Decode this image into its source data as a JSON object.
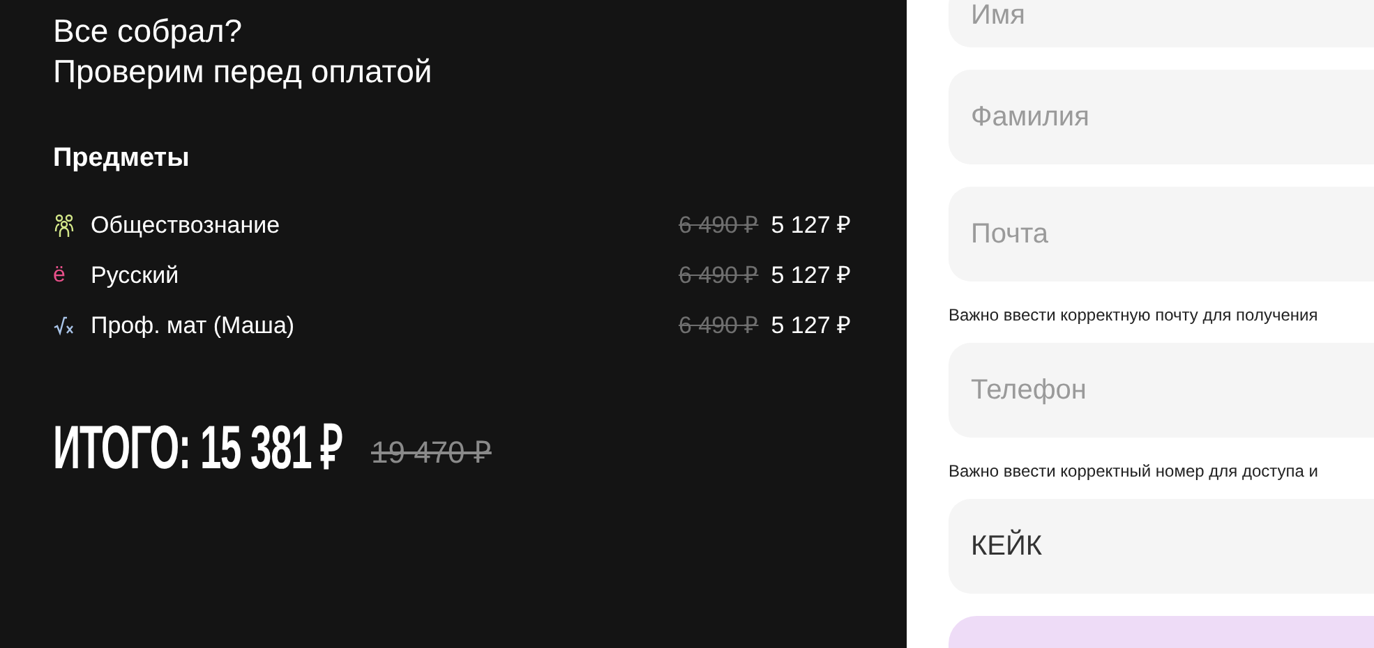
{
  "checkout": {
    "title_lines": [
      "Все собрал?",
      "Проверим перед оплатой"
    ],
    "section_title": "Предметы",
    "items": [
      {
        "name": "Обществознание",
        "kind": "people",
        "color": "#d4e88a",
        "old_price": "6 490 ₽",
        "price": "5 127 ₽"
      },
      {
        "name": "Русский",
        "kind": "letter",
        "icon_text": "ё",
        "color": "#e8508a",
        "old_price": "6 490 ₽",
        "price": "5 127 ₽"
      },
      {
        "name": "Проф. мат (Маша)",
        "kind": "root",
        "color": "#a9c4e8",
        "old_price": "6 490 ₽",
        "price": "5 127 ₽"
      }
    ],
    "total_label": "ИТОГО: 15 381 ₽",
    "total_old": "19 470 ₽"
  },
  "form": {
    "fields": [
      {
        "placeholder": "Имя"
      },
      {
        "placeholder": "Фамилия"
      },
      {
        "placeholder": "Почта",
        "note": "Важно ввести корректную почту для получения"
      },
      {
        "placeholder": "Телефон",
        "note": "Важно ввести корректный номер для доступа и"
      },
      {
        "value": "КЕЙК"
      }
    ]
  }
}
